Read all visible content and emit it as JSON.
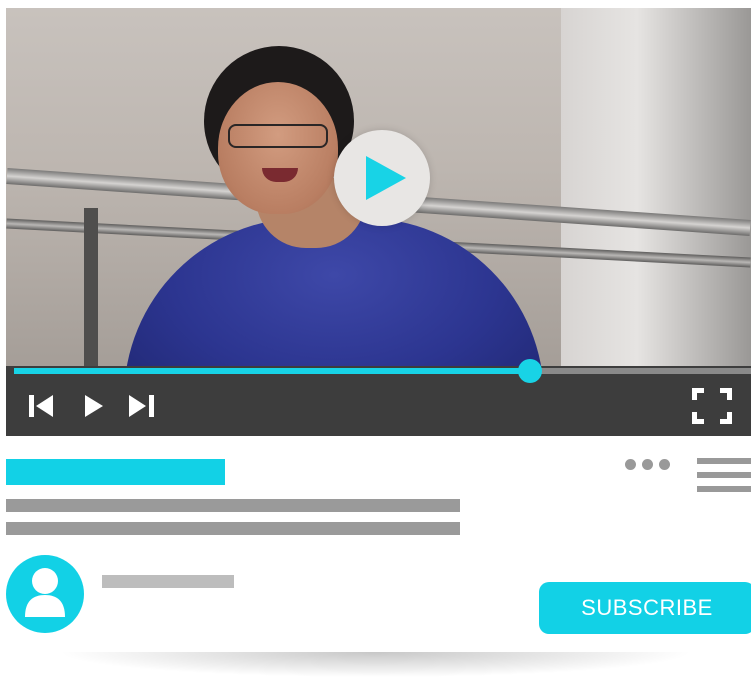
{
  "player": {
    "progress_fraction": 0.7,
    "controls": {
      "previous_icon": "skip-previous-icon",
      "play_icon": "play-icon",
      "next_icon": "skip-next-icon",
      "fullscreen_icon": "fullscreen-icon",
      "big_play_icon": "play-circle-icon"
    }
  },
  "video_info": {
    "more_icon": "more-horizontal-icon",
    "menu_icon": "hamburger-menu-icon"
  },
  "channel": {
    "avatar_icon": "user-icon",
    "subscribe_label": "SUBSCRIBE"
  },
  "colors": {
    "accent": "#12d1e6",
    "control_bar": "#3d3d3d",
    "placeholder_gray": "#9a9a9a"
  }
}
